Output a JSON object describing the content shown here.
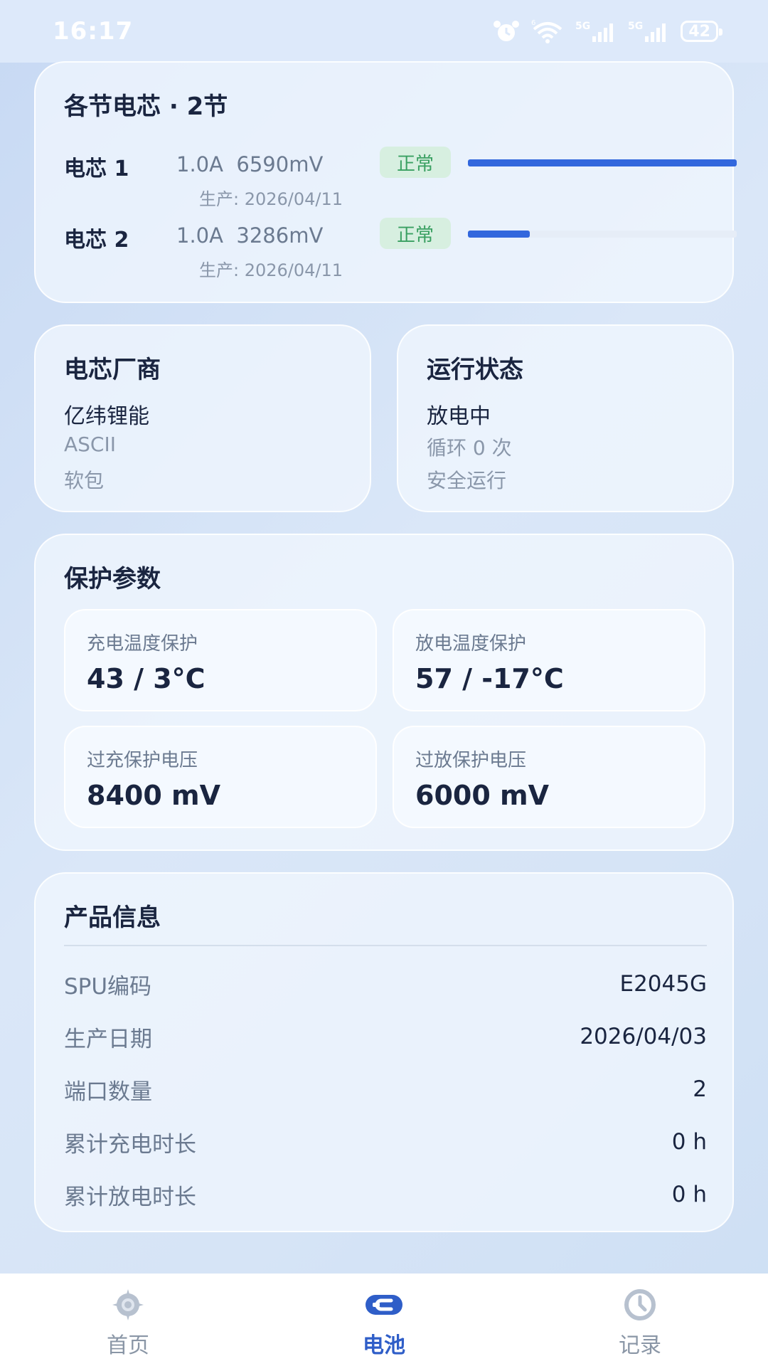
{
  "status_bar": {
    "time": "16:17",
    "battery": "42",
    "icons": [
      "alarm-icon",
      "wifi-icon",
      "signal-5g-icon",
      "signal-5g-icon",
      "battery-icon"
    ]
  },
  "cells": {
    "title": "各节电芯 · 2节",
    "items": [
      {
        "name": "电芯 1",
        "stats": "1.0A  6590mV",
        "badge": "正常",
        "date": "生产: 2026/04/11",
        "level": 1.0
      },
      {
        "name": "电芯 2",
        "stats": "1.0A  3286mV",
        "badge": "正常",
        "date": "生产: 2026/04/11",
        "level": 0.23
      }
    ]
  },
  "vendor": {
    "title": "电芯厂商",
    "name": "亿纬锂能",
    "code": "ASCII",
    "package": "软包"
  },
  "run_state": {
    "title": "运行状态",
    "state": "放电中",
    "cycles": "循环 0 次",
    "safety": "安全运行"
  },
  "protection": {
    "title": "保护参数",
    "items": [
      {
        "label": "充电温度保护",
        "value": "43 / 3°C"
      },
      {
        "label": "放电温度保护",
        "value": "57 / -17°C"
      },
      {
        "label": "过充保护电压",
        "value": "8400 mV"
      },
      {
        "label": "过放保护电压",
        "value": "6000 mV"
      }
    ]
  },
  "product": {
    "title": "产品信息",
    "rows": [
      {
        "label": "SPU编码",
        "value": "E2045G"
      },
      {
        "label": "生产日期",
        "value": "2026/04/03"
      },
      {
        "label": "端口数量",
        "value": "2"
      },
      {
        "label": "累计充电时长",
        "value": "0 h"
      },
      {
        "label": "累计放电时长",
        "value": "0 h"
      }
    ]
  },
  "nav": {
    "items": [
      {
        "label": "首页",
        "icon": "home-compass-icon",
        "active": false
      },
      {
        "label": "电池",
        "icon": "battery-plug-icon",
        "active": true
      },
      {
        "label": "记录",
        "icon": "clock-icon",
        "active": false
      }
    ],
    "active_color": "#2f5ec8",
    "inactive_color": "#8a96a6"
  }
}
